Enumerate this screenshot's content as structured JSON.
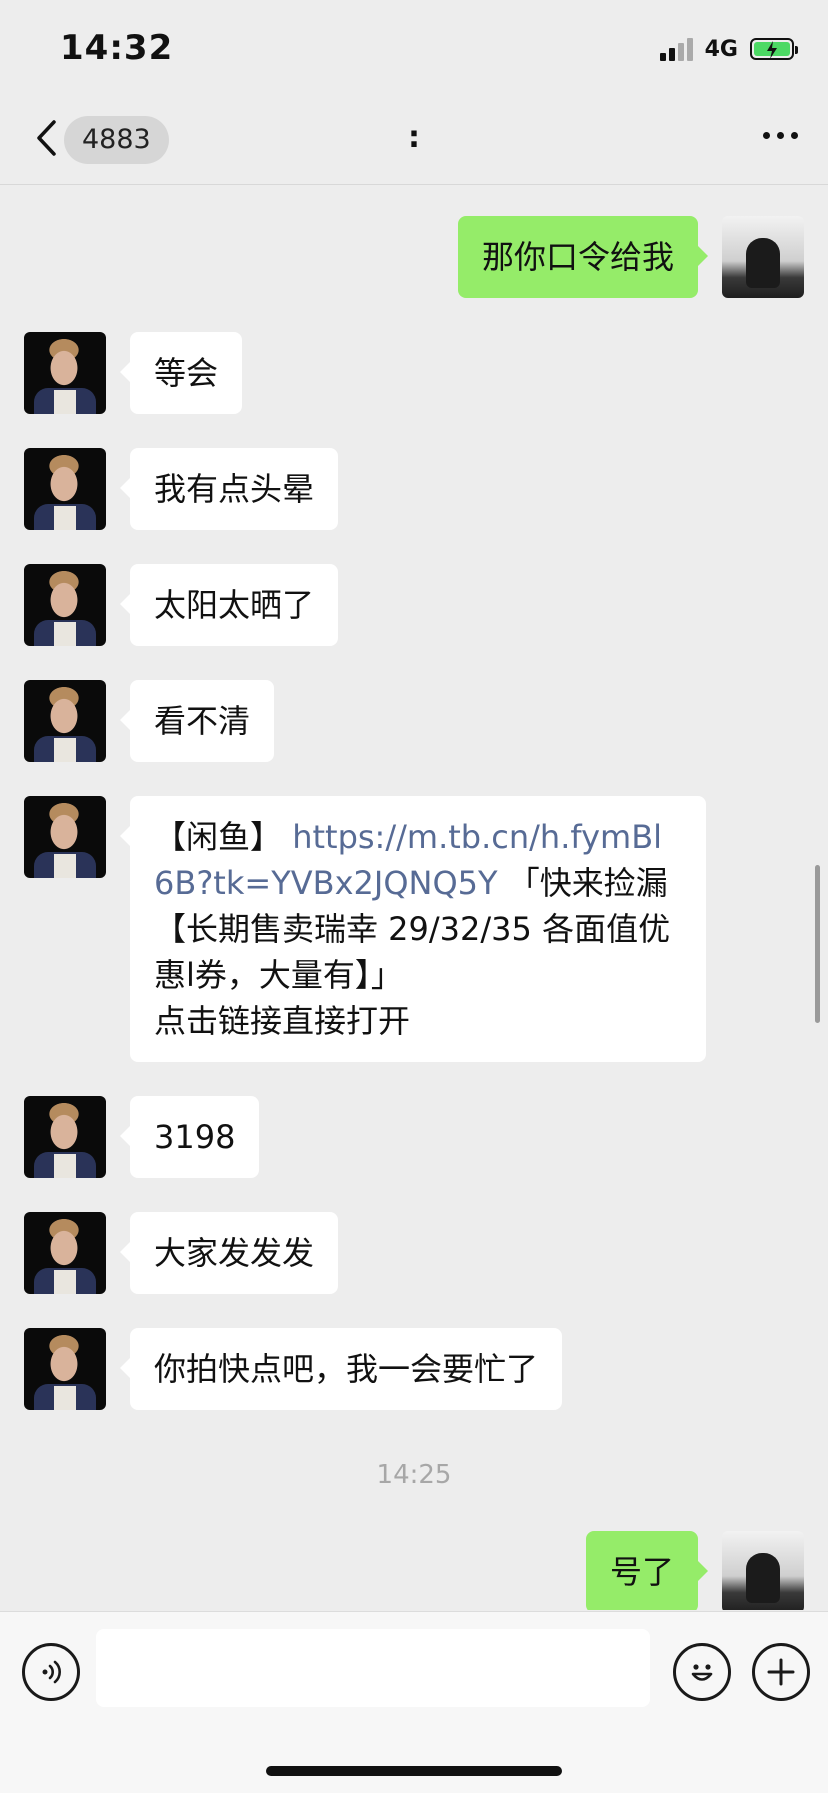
{
  "status_bar": {
    "time": "14:32",
    "network": "4G"
  },
  "nav": {
    "unread_count": "4883",
    "title": ":"
  },
  "messages": [
    {
      "from": "self",
      "text": "那你口令给我"
    },
    {
      "from": "other",
      "text": "等会"
    },
    {
      "from": "other",
      "text": "我有点头晕"
    },
    {
      "from": "other",
      "text": "太阳太晒了"
    },
    {
      "from": "other",
      "text": "看不清"
    },
    {
      "from": "other",
      "prefix": "【闲鱼】 ",
      "link": "https://m.tb.cn/h.fymBl6B?tk=YVBx2JQNQ5Y",
      "suffix": " 「快来捡漏【长期售卖瑞幸 29/32/35 各面值优惠l券，大量有】」\n点击链接直接打开"
    },
    {
      "from": "other",
      "text": "3198"
    },
    {
      "from": "other",
      "text": "大家发发发"
    },
    {
      "from": "other",
      "text": "你拍快点吧，我一会要忙了"
    },
    {
      "from": "self",
      "text": "号了"
    }
  ],
  "timestamp": "14:25",
  "input": {
    "placeholder": ""
  },
  "icons": [
    "back-icon",
    "more-icon",
    "voice-icon",
    "emoji-icon",
    "plus-icon"
  ]
}
